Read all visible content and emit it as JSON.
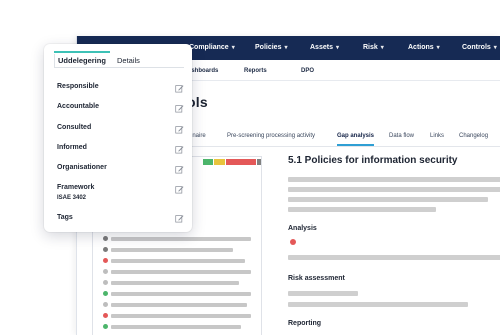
{
  "nav": {
    "items": [
      {
        "label": "Compliance"
      },
      {
        "label": "Policies"
      },
      {
        "label": "Assets"
      },
      {
        "label": "Risk"
      },
      {
        "label": "Actions"
      },
      {
        "label": "Controls"
      }
    ]
  },
  "subnav": {
    "items": [
      {
        "label": "ashboards"
      },
      {
        "label": "Reports"
      },
      {
        "label": "DPO"
      }
    ]
  },
  "page": {
    "title_fragment": "ols"
  },
  "tabs": [
    {
      "label": "nnaire"
    },
    {
      "label": "Pre-screening processing activity"
    },
    {
      "label": "Gap analysis"
    },
    {
      "label": "Data flow"
    },
    {
      "label": "Links"
    },
    {
      "label": "Changelog"
    }
  ],
  "detail": {
    "heading": "5.1 Policies for information security",
    "analysis_label": "Analysis",
    "risk_label": "Risk assessment",
    "reporting_label": "Reporting"
  },
  "colors": {
    "nav_bg": "#162a54",
    "accent_teal": "#3dc1b6",
    "active_tab": "#2f9fd4",
    "status_red": "#e45858",
    "status_green": "#4cb56b",
    "status_yellow": "#e8c43d",
    "status_gray": "#808080"
  },
  "popup": {
    "tabs": [
      {
        "label": "Uddelegering"
      },
      {
        "label": "Details"
      }
    ],
    "fields": [
      {
        "label": "Responsible"
      },
      {
        "label": "Accountable"
      },
      {
        "label": "Consulted"
      },
      {
        "label": "Informed"
      },
      {
        "label": "Organisationer"
      },
      {
        "label": "Framework",
        "value": "ISAE 3402"
      },
      {
        "label": "Tags"
      }
    ],
    "icon": "edit-icon"
  }
}
